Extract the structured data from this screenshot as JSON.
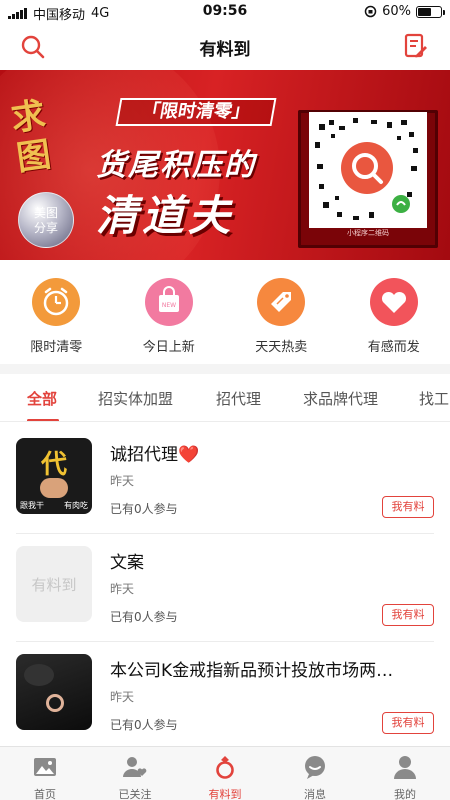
{
  "status_bar": {
    "carrier": "中国移动",
    "network": "4G",
    "time": "09:56",
    "battery": "60%",
    "battery_level": 0.6
  },
  "header": {
    "title": "有料到",
    "search_icon": "search-icon",
    "edit_icon": "edit-document-icon"
  },
  "banner": {
    "stamp": "求图",
    "share_label_1": "美图",
    "share_label_2": "分享",
    "tag": "「限时清零」",
    "line1": "货尾积压的",
    "line2": "清道夫",
    "qr_caption": "小程序二维码",
    "active_dot": 1,
    "dot_count": 2
  },
  "quick_categories": [
    {
      "label": "限时清零",
      "icon": "alarm-clock-icon",
      "color": "#f39a3b"
    },
    {
      "label": "今日上新",
      "icon": "new-bag-icon",
      "color": "#f27aa0"
    },
    {
      "label": "天天热卖",
      "icon": "price-tag-icon",
      "color": "#f6883e"
    },
    {
      "label": "有感而发",
      "icon": "heart-icon",
      "color": "#f2545b"
    }
  ],
  "tabs": [
    "全部",
    "招实体加盟",
    "招代理",
    "求品牌代理",
    "找工"
  ],
  "posts": [
    {
      "title": "诚招代理❤️",
      "time": "昨天",
      "participants": "已有0人参与",
      "button": "我有料",
      "thumb_text": "代",
      "thumb_caption_1": "跟我干",
      "thumb_caption_2": "有肉吃"
    },
    {
      "title": "文案",
      "time": "昨天",
      "participants": "已有0人参与",
      "button": "我有料",
      "thumb_text": "有料到"
    },
    {
      "title": "本公司K金戒指新品预计投放市场两…",
      "time": "昨天",
      "participants": "已有0人参与",
      "button": "我有料"
    }
  ],
  "bottom_nav": [
    {
      "label": "首页",
      "icon": "image-icon"
    },
    {
      "label": "已关注",
      "icon": "followed-user-icon"
    },
    {
      "label": "有料到",
      "icon": "ring-icon",
      "active": true
    },
    {
      "label": "消息",
      "icon": "message-icon"
    },
    {
      "label": "我的",
      "icon": "user-icon"
    }
  ],
  "colors": {
    "accent": "#e2433c",
    "banner_red": "#d82224"
  }
}
